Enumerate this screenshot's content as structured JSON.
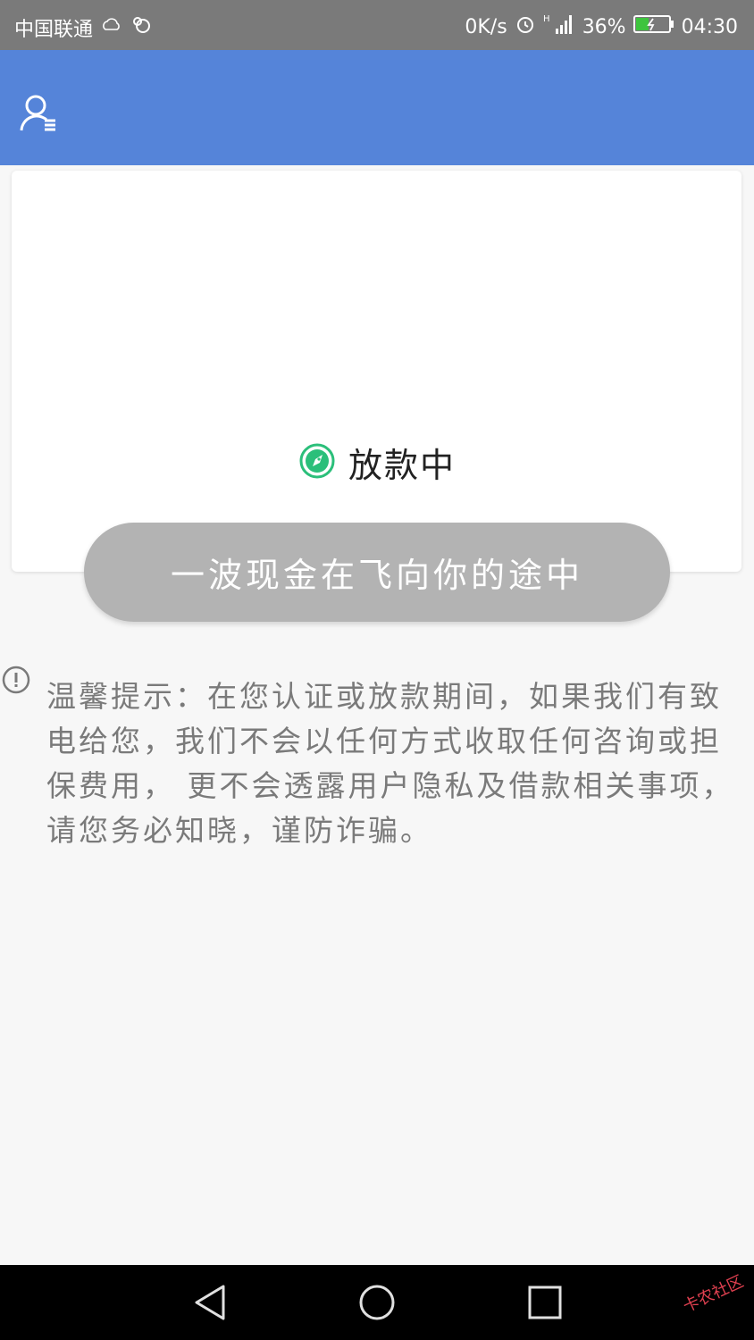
{
  "status_bar": {
    "carrier": "中国联通",
    "net_speed": "0K/s",
    "battery_percent": "36%",
    "time": "04:30",
    "icons": [
      "weather-icon",
      "squirrel-icon",
      "alarm-icon",
      "signal-icon",
      "battery-icon"
    ]
  },
  "app_bar": {
    "color": "#5584d9",
    "left_icon": "profile-icon"
  },
  "status_card": {
    "status_icon": "rocket-icon",
    "status_icon_color": "#2bbf7a",
    "status_label": "放款中",
    "button_label": "一波现金在飞向你的途中",
    "button_color": "#b3b3b3"
  },
  "notice": {
    "icon": "exclamation-circle-icon",
    "text": "温馨提示：在您认证或放款期间，如果我们有致电给您，我们不会以任何方式收取任何咨询或担保费用， 更不会透露用户隐私及借款相关事项，请您务必知晓，谨防诈骗。"
  },
  "nav_bar": {
    "buttons": [
      "back-icon",
      "home-icon",
      "recents-icon"
    ]
  },
  "watermark": {
    "text": "卡农社区"
  }
}
